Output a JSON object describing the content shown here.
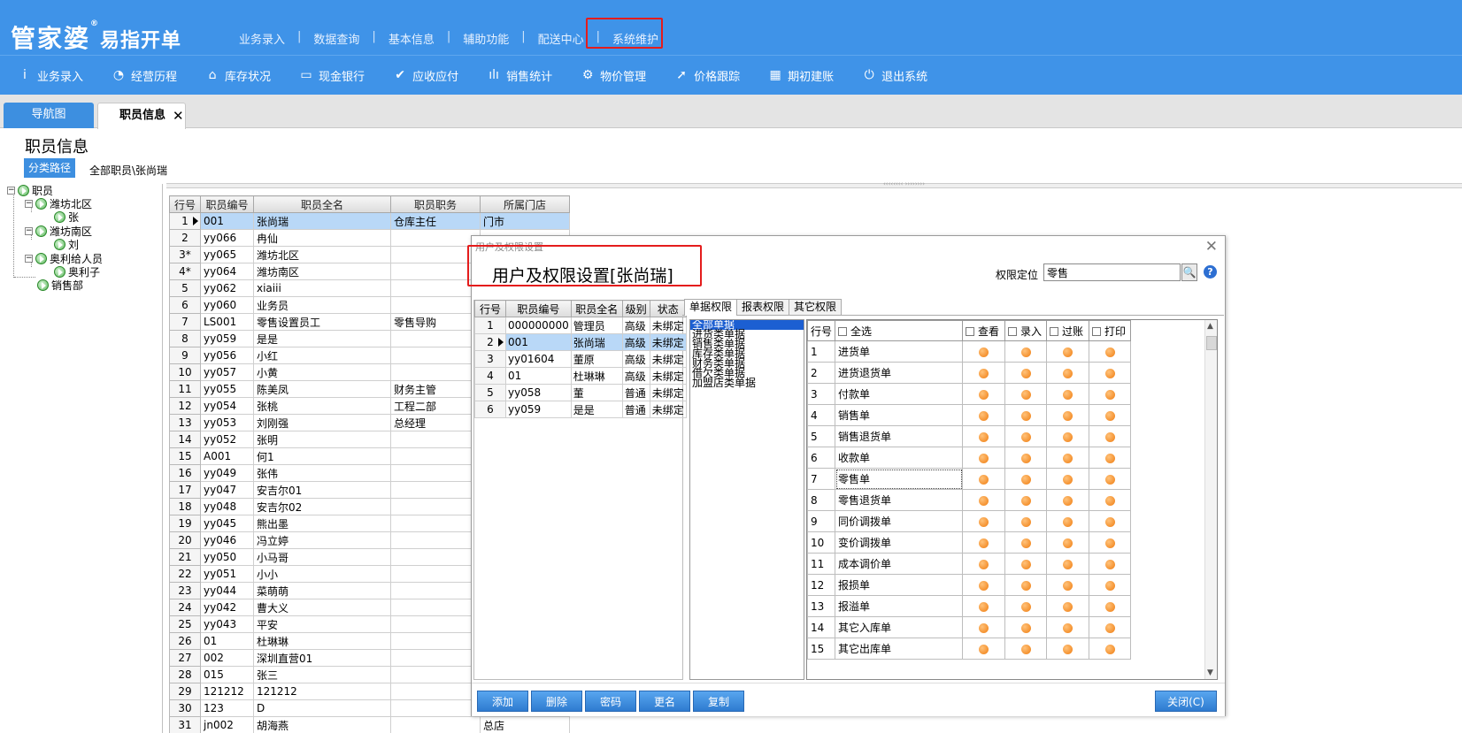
{
  "header": {
    "logo_main": "管家婆",
    "logo_reg": "®",
    "logo_sub": "易指开单",
    "top_menu": [
      "业务录入",
      "数据查询",
      "基本信息",
      "辅助功能",
      "配送中心",
      "系统维护"
    ],
    "menu_sep": "|"
  },
  "toolbar": [
    {
      "label": "业务录入",
      "icon": "ⅰ"
    },
    {
      "label": "经营历程",
      "icon": "◔"
    },
    {
      "label": "库存状况",
      "icon": "⌂"
    },
    {
      "label": "现金银行",
      "icon": "▭"
    },
    {
      "label": "应收应付",
      "icon": "✔"
    },
    {
      "label": "销售统计",
      "icon": "ılı"
    },
    {
      "label": "物价管理",
      "icon": "⚙"
    },
    {
      "label": "价格跟踪",
      "icon": "➚"
    },
    {
      "label": "期初建账",
      "icon": "▦"
    },
    {
      "label": "退出系统",
      "icon": "⏻"
    }
  ],
  "tabs": {
    "nav": "导航图",
    "staff": "职员信息",
    "close": "✕"
  },
  "page": {
    "title": "职员信息",
    "path_button": "分类路径",
    "path_text": "全部职员\\张尚瑞"
  },
  "tree": {
    "root": "职员",
    "n1": "潍坊北区",
    "n1c": "张",
    "n2": "潍坊南区",
    "n2c": "刘",
    "n3": "奥利给人员",
    "n3c": "奥利子",
    "n4": "销售部"
  },
  "splitter_text": "‹‹‹‹‹‹‹‹  ››››››››",
  "staff_grid": {
    "headers": [
      "行号",
      "职员编号",
      "职员全名",
      "职员职务",
      "所属门店"
    ],
    "rows": [
      [
        "1",
        "001",
        "张尚瑞",
        "仓库主任",
        "门市"
      ],
      [
        "2",
        "yy066",
        "冉仙",
        "",
        ""
      ],
      [
        "3*",
        "yy065",
        "潍坊北区",
        "",
        ""
      ],
      [
        "4*",
        "yy064",
        "潍坊南区",
        "",
        ""
      ],
      [
        "5",
        "yy062",
        "xiaiii",
        "",
        ""
      ],
      [
        "6",
        "yy060",
        "业务员",
        "",
        ""
      ],
      [
        "7",
        "LS001",
        "零售设置员工",
        "零售导购",
        ""
      ],
      [
        "8",
        "yy059",
        "是是",
        "",
        ""
      ],
      [
        "9",
        "yy056",
        "小红",
        "",
        ""
      ],
      [
        "10",
        "yy057",
        "小黄",
        "",
        ""
      ],
      [
        "11",
        "yy055",
        "陈美凤",
        "财务主管",
        ""
      ],
      [
        "12",
        "yy054",
        "张桃",
        "工程二部",
        ""
      ],
      [
        "13",
        "yy053",
        "刘刚强",
        "总经理",
        ""
      ],
      [
        "14",
        "yy052",
        "张明",
        "",
        ""
      ],
      [
        "15",
        "A001",
        "何1",
        "",
        ""
      ],
      [
        "16",
        "yy049",
        "张伟",
        "",
        ""
      ],
      [
        "17",
        "yy047",
        "安吉尔01",
        "",
        ""
      ],
      [
        "18",
        "yy048",
        "安吉尔02",
        "",
        ""
      ],
      [
        "19",
        "yy045",
        "熊出墨",
        "",
        ""
      ],
      [
        "20",
        "yy046",
        "冯立婷",
        "",
        ""
      ],
      [
        "21",
        "yy050",
        "小马哥",
        "",
        ""
      ],
      [
        "22",
        "yy051",
        "小小",
        "",
        ""
      ],
      [
        "23",
        "yy044",
        "菜萌萌",
        "",
        ""
      ],
      [
        "24",
        "yy042",
        "曹大义",
        "",
        ""
      ],
      [
        "25",
        "yy043",
        "平安",
        "",
        ""
      ],
      [
        "26",
        "01",
        "杜琳琳",
        "",
        ""
      ],
      [
        "27",
        "002",
        "深圳直营01",
        "",
        ""
      ],
      [
        "28",
        "015",
        "张三",
        "",
        ""
      ],
      [
        "29",
        "121212",
        "121212",
        "",
        ""
      ],
      [
        "30",
        "123",
        "D",
        "",
        ""
      ],
      [
        "31",
        "jn002",
        "胡海燕",
        "",
        "总店"
      ]
    ]
  },
  "dialog": {
    "caption": "用户及权限设置",
    "title": "用户及权限设置[张尚瑞]",
    "close": "✕",
    "locate_label": "权限定位",
    "locate_value": "零售",
    "locate_icon": "search-icon",
    "help": "?",
    "user_grid": {
      "headers": [
        "行号",
        "职员编号",
        "职员全名",
        "级别",
        "状态"
      ],
      "rows": [
        [
          "1",
          "000000000",
          "管理员",
          "高级",
          "未绑定"
        ],
        [
          "2",
          "001",
          "张尚瑞",
          "高级",
          "未绑定"
        ],
        [
          "3",
          "yy01604",
          "董原",
          "高级",
          "未绑定"
        ],
        [
          "4",
          "01",
          "杜琳琳",
          "高级",
          "未绑定"
        ],
        [
          "5",
          "yy058",
          "董",
          "普通",
          "未绑定"
        ],
        [
          "6",
          "yy059",
          "是是",
          "普通",
          "未绑定"
        ]
      ]
    },
    "perm_tabs": [
      "单据权限",
      "报表权限",
      "其它权限"
    ],
    "categories": [
      "全部单据",
      "进货类单据",
      "销售类单据",
      "库存类单据",
      "财务类单据",
      "借欠类单据",
      "加盟店类单据"
    ],
    "perm_headers": {
      "rn": "行号",
      "all": "全选",
      "view": "查看",
      "entry": "录入",
      "post": "过账",
      "print": "打印"
    },
    "perm_rows": [
      [
        "1",
        "进货单"
      ],
      [
        "2",
        "进货退货单"
      ],
      [
        "3",
        "付款单"
      ],
      [
        "4",
        "销售单"
      ],
      [
        "5",
        "销售退货单"
      ],
      [
        "6",
        "收款单"
      ],
      [
        "7",
        "零售单"
      ],
      [
        "8",
        "零售退货单"
      ],
      [
        "9",
        "同价调拨单"
      ],
      [
        "10",
        "变价调拨单"
      ],
      [
        "11",
        "成本调价单"
      ],
      [
        "12",
        "报损单"
      ],
      [
        "13",
        "报溢单"
      ],
      [
        "14",
        "其它入库单"
      ],
      [
        "15",
        "其它出库单"
      ]
    ],
    "buttons": {
      "add": "添加",
      "delete": "删除",
      "password": "密码",
      "rename": "更名",
      "copy": "复制",
      "close": "关闭(C)"
    }
  },
  "colors": {
    "header_blue": "#3f93e8",
    "highlight_red": "#e41c1c",
    "dot_orange": "#f07d10",
    "selection": "#b9d8f7"
  }
}
